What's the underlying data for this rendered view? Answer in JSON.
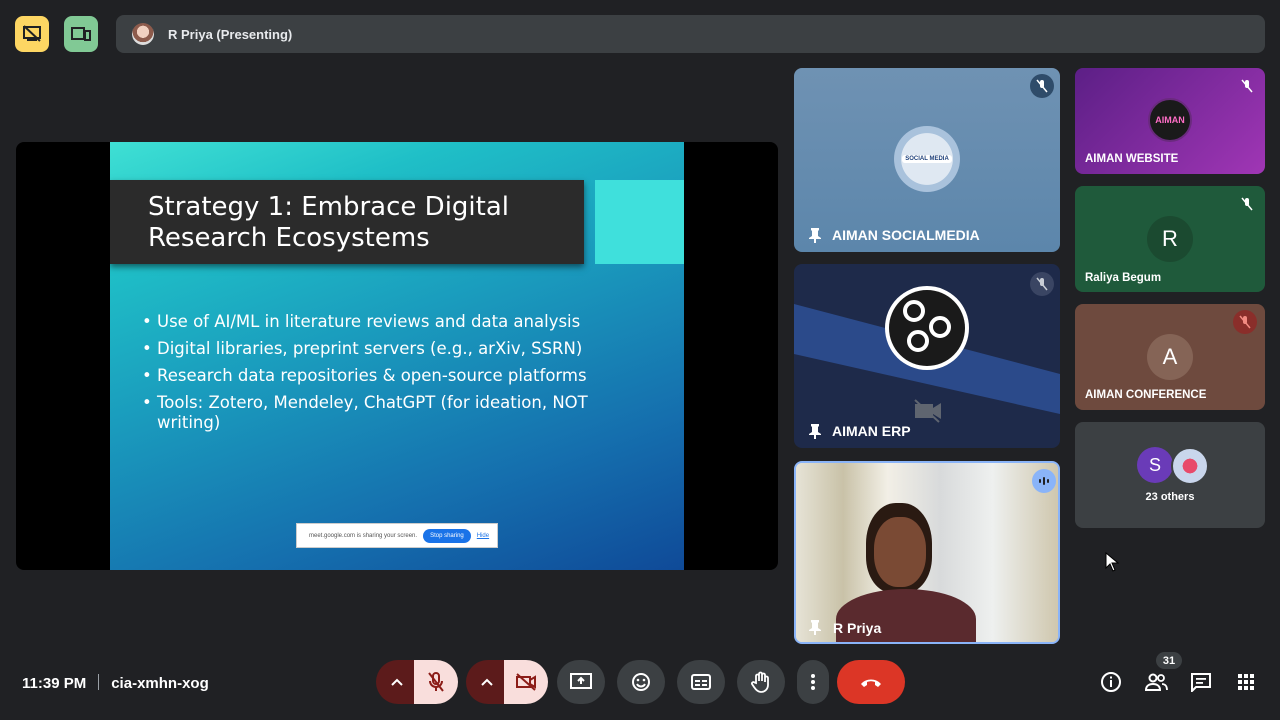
{
  "top": {
    "presenter_label": "R Priya (Presenting)"
  },
  "slide": {
    "title": "Strategy 1: Embrace Digital Research Ecosystems",
    "bullets": [
      "Use of AI/ML in literature reviews and data analysis",
      "Digital libraries, preprint servers (e.g., arXiv, SSRN)",
      "Research data repositories & open-source platforms",
      "Tools: Zotero, Mendeley, ChatGPT (for ideation, NOT writing)"
    ],
    "share_banner": {
      "text": "meet.google.com is sharing your screen.",
      "stop_label": "Stop sharing",
      "hide_label": "Hide"
    }
  },
  "tiles": {
    "social": {
      "name": "AIMAN SOCIALMEDIA",
      "logo_text": "SOCIAL MEDIA"
    },
    "erp": {
      "name": "AIMAN ERP"
    },
    "priya": {
      "name": "R Priya"
    },
    "website": {
      "name": "AIMAN WEBSITE",
      "logo_text": "AIMAN"
    },
    "raliya": {
      "name": "Raliya Begum",
      "initial": "R"
    },
    "conference": {
      "name": "AIMAN CONFERENCE",
      "initial": "A"
    },
    "others": {
      "label": "23 others",
      "initial": "S"
    }
  },
  "bottom": {
    "time": "11:39 PM",
    "meeting_code": "cia-xmhn-xog",
    "people_count": "31"
  },
  "icons": {
    "hide": "presentation-off-icon",
    "layout": "layout-icon",
    "mic_off": "mic-off-icon",
    "camera_off": "videocam-off-icon",
    "present": "present-screen-icon",
    "emoji": "emoji-icon",
    "captions": "captions-icon",
    "raise_hand": "raise-hand-icon",
    "more": "more-vert-icon",
    "end_call": "call-end-icon",
    "info": "info-icon",
    "people": "people-icon",
    "chat": "chat-icon",
    "activities": "apps-grid-icon"
  },
  "colors": {
    "end_call": "#dc3626",
    "hide_btn": "#fdd663",
    "layout_btn": "#81c995",
    "active_border": "#8ab4f8"
  }
}
